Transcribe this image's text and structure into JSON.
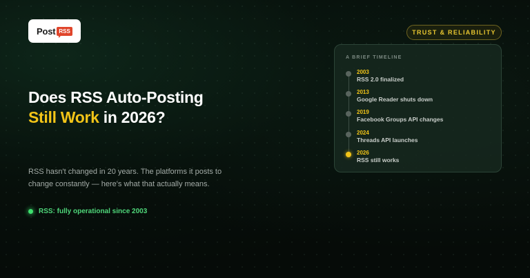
{
  "logo": {
    "word": "Post",
    "bubble": "RSS"
  },
  "badge": {
    "label": "TRUST & RELIABILITY"
  },
  "headline": {
    "line1": "Does RSS Auto-Posting",
    "highlight": "Still Work",
    "rest": " in 2026?"
  },
  "subtext": "RSS hasn't changed in 20 years. The platforms it posts to change constantly — here's what that actually means.",
  "status": {
    "label": "RSS: fully operational since 2003"
  },
  "timeline": {
    "title": "A BRIEF TIMELINE",
    "items": [
      {
        "year": "2003",
        "text": "RSS 2.0 finalized"
      },
      {
        "year": "2013",
        "text": "Google Reader shuts down"
      },
      {
        "year": "2019",
        "text": "Facebook Groups API changes"
      },
      {
        "year": "2024",
        "text": "Threads API launches"
      },
      {
        "year": "2026",
        "text": "RSS still works"
      }
    ]
  },
  "colors": {
    "accent": "#f2c418",
    "status": "#3ee06e",
    "logo_bubble": "#e0452b"
  }
}
